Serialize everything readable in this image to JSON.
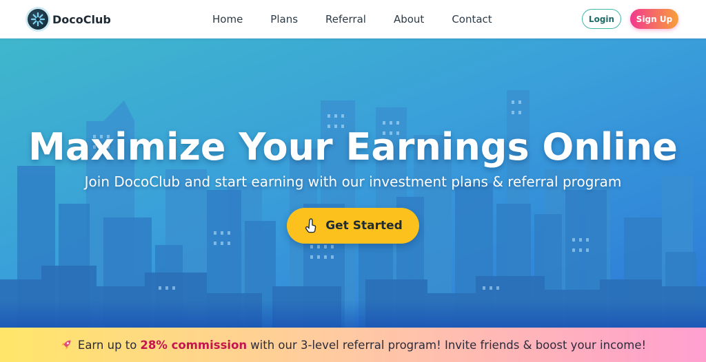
{
  "brand": {
    "name": "DocoClub",
    "logo_icon": "snowflake-icon"
  },
  "nav": {
    "items": [
      {
        "label": "Home"
      },
      {
        "label": "Plans"
      },
      {
        "label": "Referral"
      },
      {
        "label": "About"
      },
      {
        "label": "Contact"
      }
    ]
  },
  "auth": {
    "login_label": "Login",
    "signup_label": "Sign Up"
  },
  "hero": {
    "title": "Maximize Your Earnings Online",
    "subtitle": "Join DocoClub and start earning with our investment plans & referral program",
    "cta_label": "Get Started",
    "cta_icon": "pointer-hand-icon"
  },
  "promo": {
    "icon": "rocket-icon",
    "text_before": "Earn up to",
    "highlight": "28% commission",
    "text_after": "with our 3-level referral program! Invite friends & boost your income!"
  },
  "colors": {
    "hero_gradient_start": "#3fb7cc",
    "hero_gradient_end": "#2c78d8",
    "cta_background": "#fcc11d",
    "signup_gradient_start": "#f2388f",
    "signup_gradient_end": "#f7a03a",
    "login_border": "#3fb7a8",
    "highlight_text": "#c4164c"
  }
}
